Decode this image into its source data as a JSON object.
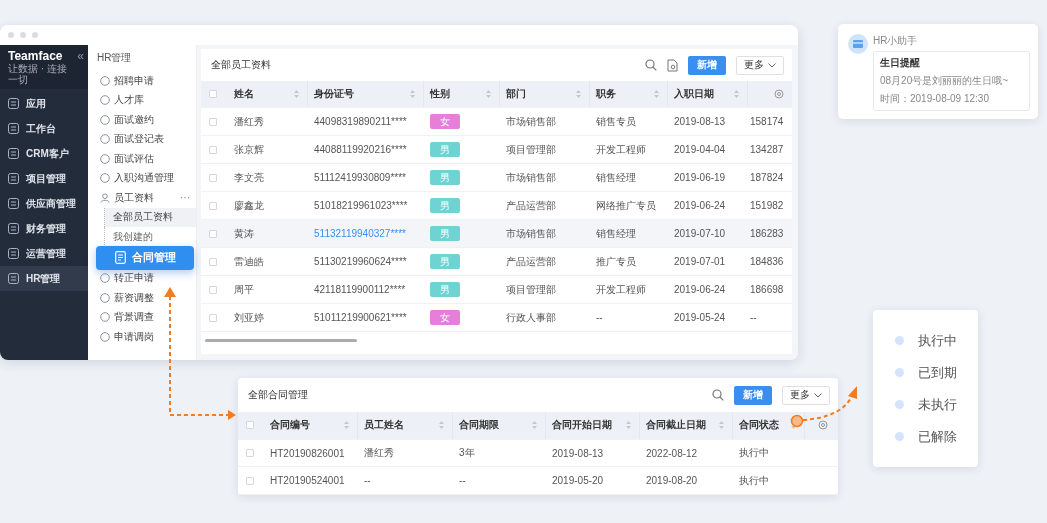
{
  "main_window": {
    "sidebar": {
      "logo": "Teamface",
      "tagline": "让数据 · 连接一切",
      "collapse_glyph": "«",
      "items": [
        {
          "label": "应用",
          "selected": false
        },
        {
          "label": "工作台",
          "selected": false
        },
        {
          "label": "CRM客户",
          "selected": false
        },
        {
          "label": "项目管理",
          "selected": false
        },
        {
          "label": "供应商管理",
          "selected": false
        },
        {
          "label": "财务管理",
          "selected": false
        },
        {
          "label": "运营管理",
          "selected": false
        },
        {
          "label": "HR管理",
          "selected": true
        }
      ]
    },
    "subnav": {
      "title": "HR管理",
      "items": [
        {
          "kind": "item",
          "label": "招聘申请"
        },
        {
          "kind": "item",
          "label": "人才库"
        },
        {
          "kind": "item",
          "label": "面试邀约"
        },
        {
          "kind": "item",
          "label": "面试登记表"
        },
        {
          "kind": "item",
          "label": "面试评估"
        },
        {
          "kind": "item",
          "label": "入职沟通管理"
        },
        {
          "kind": "group",
          "label": "员工资料",
          "more": "···",
          "expanded": true,
          "children": [
            {
              "label": "全部员工资料",
              "selected": true
            },
            {
              "label": "我创建的",
              "selected": false
            }
          ]
        },
        {
          "kind": "callout",
          "label": "合同管理"
        },
        {
          "kind": "item",
          "label": "转正申请"
        },
        {
          "kind": "item",
          "label": "薪资调整"
        },
        {
          "kind": "item",
          "label": "背景调查"
        },
        {
          "kind": "item",
          "label": "申请调岗"
        }
      ]
    },
    "employees": {
      "title": "全部员工资料",
      "new_button": "新增",
      "more_button": "更多",
      "header_checked": false,
      "columns": [
        "姓名",
        "身份证号",
        "性别",
        "部门",
        "职务",
        "入职日期"
      ],
      "rows": [
        {
          "selected": false,
          "checked": false,
          "name": "潘红秀",
          "id": "44098319890211****",
          "gender": {
            "label": "女",
            "color": "#e67fd9"
          },
          "department": "市场销售部",
          "position": "销售专员",
          "hire_date": "2019-08-13",
          "column_8": "158174"
        },
        {
          "selected": false,
          "checked": false,
          "name": "张京辉",
          "id": "44088119920216****",
          "gender": {
            "label": "男",
            "color": "#6fd3d3"
          },
          "department": "项目管理部",
          "position": "开发工程师",
          "hire_date": "2019-04-04",
          "column_8": "134287"
        },
        {
          "selected": false,
          "checked": false,
          "name": "李文亮",
          "id": "51112419930809****",
          "gender": {
            "label": "男",
            "color": "#6fd3d3"
          },
          "department": "市场销售部",
          "position": "销售经理",
          "hire_date": "2019-06-19",
          "column_8": "187824"
        },
        {
          "selected": false,
          "checked": false,
          "name": "廖鑫龙",
          "id": "51018219961023****",
          "gender": {
            "label": "男",
            "color": "#6fd3d3"
          },
          "department": "产品运营部",
          "position": "网络推广专员",
          "hire_date": "2019-06-24",
          "column_8": "151982"
        },
        {
          "selected": true,
          "checked": false,
          "name": "黄涛",
          "id": "51132119940327****",
          "gender": {
            "label": "男",
            "color": "#6fd3d3"
          },
          "department": "市场销售部",
          "position": "销售经理",
          "hire_date": "2019-07-10",
          "column_8": "186283"
        },
        {
          "selected": false,
          "checked": false,
          "name": "雷迪皓",
          "id": "51130219960624****",
          "gender": {
            "label": "男",
            "color": "#6fd3d3"
          },
          "department": "产品运营部",
          "position": "推广专员",
          "hire_date": "2019-07-01",
          "column_8": "184836"
        },
        {
          "selected": false,
          "checked": false,
          "name": "周平",
          "id": "42118119900112****",
          "gender": {
            "label": "男",
            "color": "#6fd3d3"
          },
          "department": "项目管理部",
          "position": "开发工程师",
          "hire_date": "2019-06-24",
          "column_8": "186698"
        },
        {
          "selected": false,
          "checked": false,
          "name": "刘亚婷",
          "id": "51011219900621****",
          "gender": {
            "label": "女",
            "color": "#e67fd9"
          },
          "department": "行政人事部",
          "position": "--",
          "hire_date": "2019-05-24",
          "column_8": "--"
        }
      ]
    }
  },
  "notification": {
    "sender": "HR小助手",
    "title": "生日提醒",
    "message": "08月20号是刘丽丽的生日哦~",
    "time": "时间：2019-08-09 12:30"
  },
  "contracts": {
    "title": "全部合同管理",
    "new_button": "新增",
    "more_button": "更多",
    "header_checked": false,
    "columns": [
      "合同编号",
      "员工姓名",
      "合同期限",
      "合同开始日期",
      "合同截止日期",
      "合同状态"
    ],
    "rows": [
      {
        "checked": false,
        "cells": [
          "HT20190826001",
          "潘红秀",
          "3年",
          "2019-08-13",
          "2022-08-12",
          "执行中"
        ]
      },
      {
        "checked": false,
        "cells": [
          "HT20190524001",
          "--",
          "--",
          "2019-05-20",
          "2019-08-20",
          "执行中"
        ]
      }
    ]
  },
  "status_menu": {
    "items": [
      "执行中",
      "已到期",
      "未执行",
      "已解除"
    ]
  }
}
